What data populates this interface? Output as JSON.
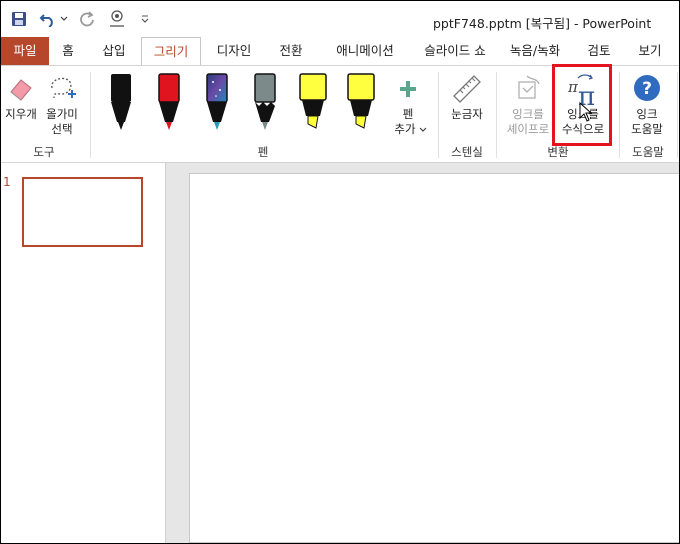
{
  "window": {
    "title": "pptF748.pptm [복구됨]  -  PowerPoint"
  },
  "quick_access": {
    "save_icon": "save-icon",
    "undo_icon": "undo-icon",
    "redo_icon": "redo-icon",
    "touch_icon": "touch-mode-icon",
    "customize_icon": "customize-icon"
  },
  "tabs": [
    "파일",
    "홈",
    "삽입",
    "그리기",
    "디자인",
    "전환",
    "애니메이션",
    "슬라이드 쇼",
    "녹음/녹화",
    "검토",
    "보기"
  ],
  "active_tab": "그리기",
  "ribbon": {
    "tools": {
      "eraser_label": "지우개",
      "lasso_line1": "올가미",
      "lasso_line2": "선택",
      "group": "도구"
    },
    "pens": {
      "group": "펜",
      "items": [
        {
          "name": "black-pen",
          "color": "#111111"
        },
        {
          "name": "red-pen",
          "color": "#e0141e"
        },
        {
          "name": "galaxy-pen",
          "color": "#2a3a7a"
        },
        {
          "name": "gray-pencil",
          "color": "#7d8a8a"
        },
        {
          "name": "yellow-highlighter",
          "color": "#ffff40"
        },
        {
          "name": "yellow-highlighter-2",
          "color": "#ffff40"
        }
      ],
      "add_line1": "펜",
      "add_line2": "추가"
    },
    "stencils": {
      "ruler_label": "눈금자",
      "group": "스텐실"
    },
    "convert": {
      "ink_to_shape_line1": "잉크를",
      "ink_to_shape_line2": "셰이프로",
      "ink_to_math_line1": "잉크를",
      "ink_to_math_line2": "수식으로",
      "group": "변환"
    },
    "help": {
      "ink_help_line1": "잉크",
      "ink_help_line2": "도움말",
      "group": "도움말"
    }
  },
  "slides_pane": {
    "slide_number": "1"
  }
}
